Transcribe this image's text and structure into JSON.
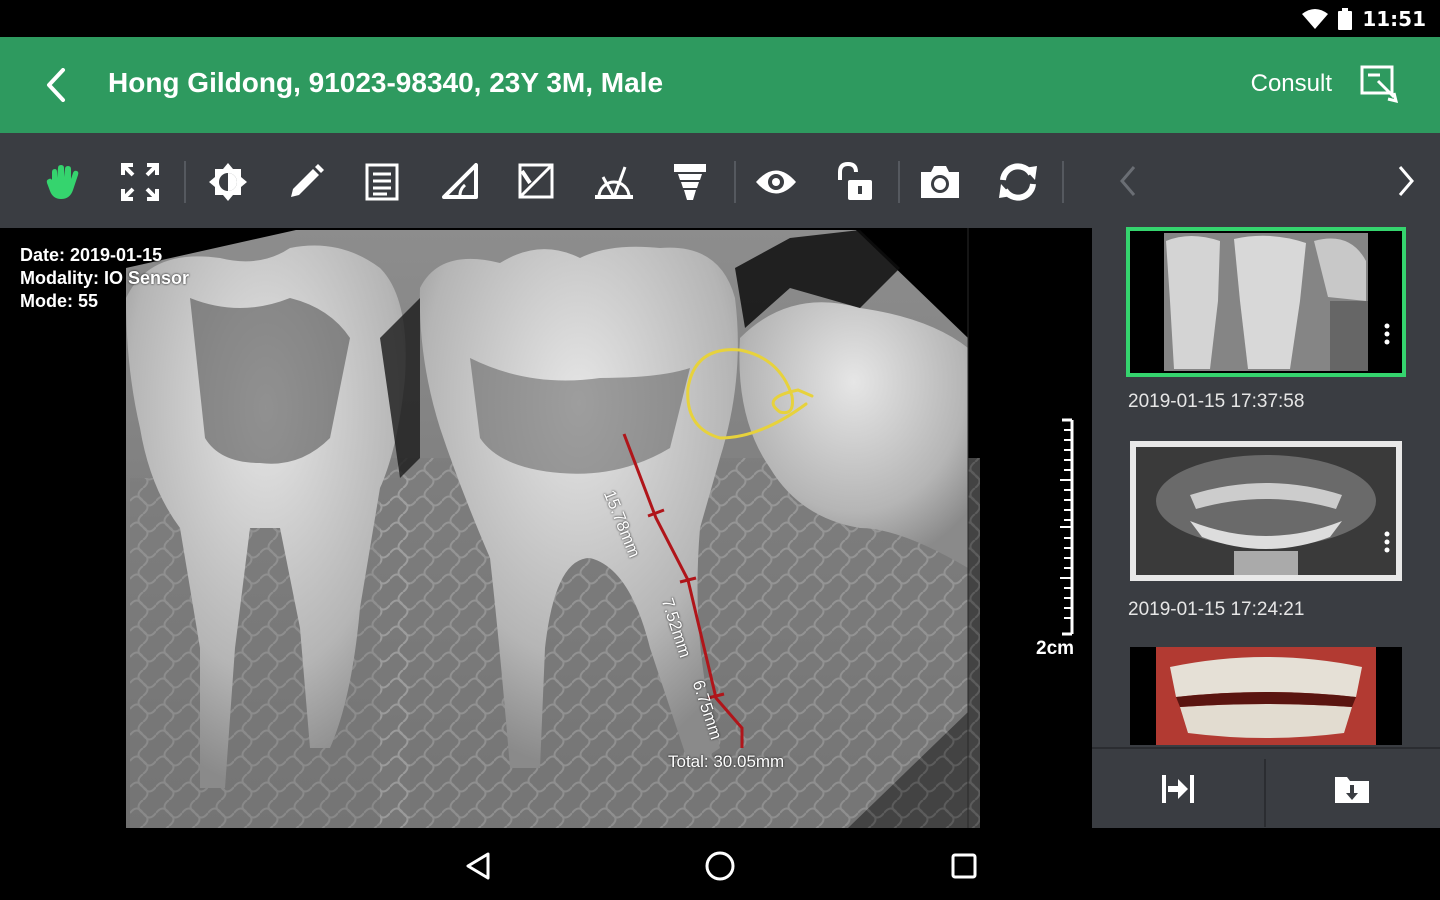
{
  "status_bar": {
    "time": "11:51"
  },
  "header": {
    "title": "Hong Gildong, 91023-98340, 23Y 3M, Male",
    "consult_label": "Consult"
  },
  "toolbar": {
    "tools": [
      "pan-hand-icon",
      "fit-screen-icon",
      "brightness-contrast-icon",
      "pencil-icon",
      "notes-icon",
      "angle-icon",
      "cobb-angle-icon",
      "protractor-icon",
      "implant-icon",
      "eye-icon",
      "unlock-icon",
      "camera-icon",
      "refresh-icon"
    ],
    "active_color": "#35d46e"
  },
  "viewer": {
    "info": {
      "date": "Date: 2019-01-15",
      "modality": "Modality: IO Sensor",
      "mode": "Mode: 55"
    },
    "scale_label": "2cm",
    "measurements": {
      "seg1": "15.78mm",
      "seg2": "7.52mm",
      "seg3": "6.75mm",
      "total": "Total: 30.05mm"
    }
  },
  "side_panel": {
    "thumbnails": [
      {
        "date": "2019-01-15 17:37:58",
        "selected": true
      },
      {
        "date": "2019-01-15 17:24:21",
        "selected": false
      },
      {
        "date": "",
        "selected": false
      }
    ]
  },
  "colors": {
    "header": "#2e9a5f",
    "panel": "#3a3d42",
    "selected_outline": "#35d46e",
    "annotation_yellow": "#e7d23c",
    "measure_red": "#b0151a"
  }
}
